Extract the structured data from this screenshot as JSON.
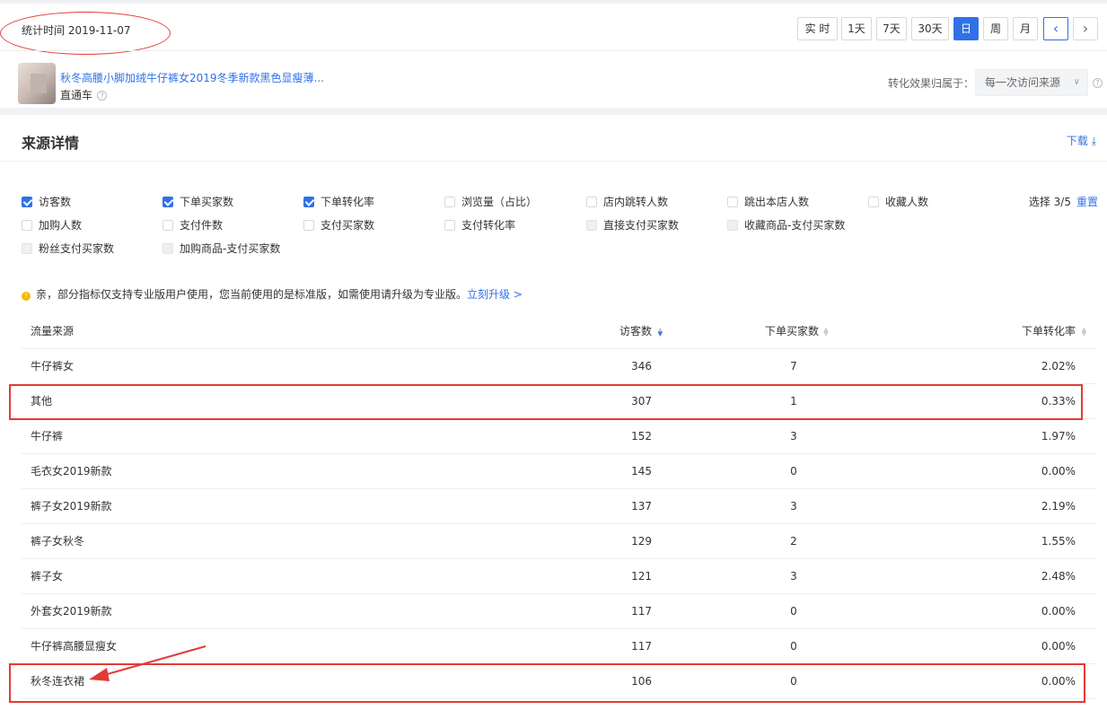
{
  "header": {
    "stat_time": "统计时间 2019-11-07",
    "range_buttons": [
      "实 时",
      "1天",
      "7天",
      "30天",
      "日",
      "周",
      "月"
    ],
    "active_range": "日",
    "prev_arrow": "‹",
    "next_arrow": "›"
  },
  "product": {
    "title": "秋冬高腰小脚加绒牛仔裤女2019冬季新款黑色显瘦薄...",
    "channel": "直通车",
    "help_glyph": "?"
  },
  "attribution": {
    "label": "转化效果归属于：",
    "value": "每一次访问来源",
    "caret": "∨"
  },
  "panel": {
    "title": "来源详情",
    "download": "下载 ⤓"
  },
  "metrics": [
    {
      "label": "访客数",
      "checked": true
    },
    {
      "label": "下单买家数",
      "checked": true
    },
    {
      "label": "下单转化率",
      "checked": true
    },
    {
      "label": "浏览量（占比）",
      "checked": false
    },
    {
      "label": "店内跳转人数",
      "checked": false
    },
    {
      "label": "跳出本店人数",
      "checked": false
    },
    {
      "label": "收藏人数",
      "checked": false
    },
    {
      "label": "加购人数",
      "checked": false
    },
    {
      "label": "支付件数",
      "checked": false
    },
    {
      "label": "支付买家数",
      "checked": false
    },
    {
      "label": "支付转化率",
      "checked": false
    },
    {
      "label": "直接支付买家数",
      "checked": false
    },
    {
      "label": "收藏商品-支付买家数",
      "checked": false
    },
    {
      "label": "粉丝支付买家数",
      "checked": false
    },
    {
      "label": "加购商品-支付买家数",
      "checked": false
    }
  ],
  "selection": {
    "text": "选择 3/5",
    "reset": "重置"
  },
  "notice": {
    "icon": "!",
    "text": "亲，部分指标仅支持专业版用户使用，您当前使用的是标准版，如需使用请升级为专业版。",
    "link": "立刻升级 >"
  },
  "table": {
    "headers": [
      "流量来源",
      "访客数",
      "下单买家数",
      "下单转化率"
    ],
    "rows": [
      [
        "牛仔裤女",
        "346",
        "7",
        "2.02%"
      ],
      [
        "其他",
        "307",
        "1",
        "0.33%"
      ],
      [
        "牛仔裤",
        "152",
        "3",
        "1.97%"
      ],
      [
        "毛衣女2019新款",
        "145",
        "0",
        "0.00%"
      ],
      [
        "裤子女2019新款",
        "137",
        "3",
        "2.19%"
      ],
      [
        "裤子女秋冬",
        "129",
        "2",
        "1.55%"
      ],
      [
        "裤子女",
        "121",
        "3",
        "2.48%"
      ],
      [
        "外套女2019新款",
        "117",
        "0",
        "0.00%"
      ],
      [
        "牛仔裤高腰显瘦女",
        "117",
        "0",
        "0.00%"
      ],
      [
        "秋冬连衣裙",
        "106",
        "0",
        "0.00%"
      ]
    ]
  },
  "colors": {
    "accent": "#3071e7",
    "annotation": "#e53935"
  }
}
